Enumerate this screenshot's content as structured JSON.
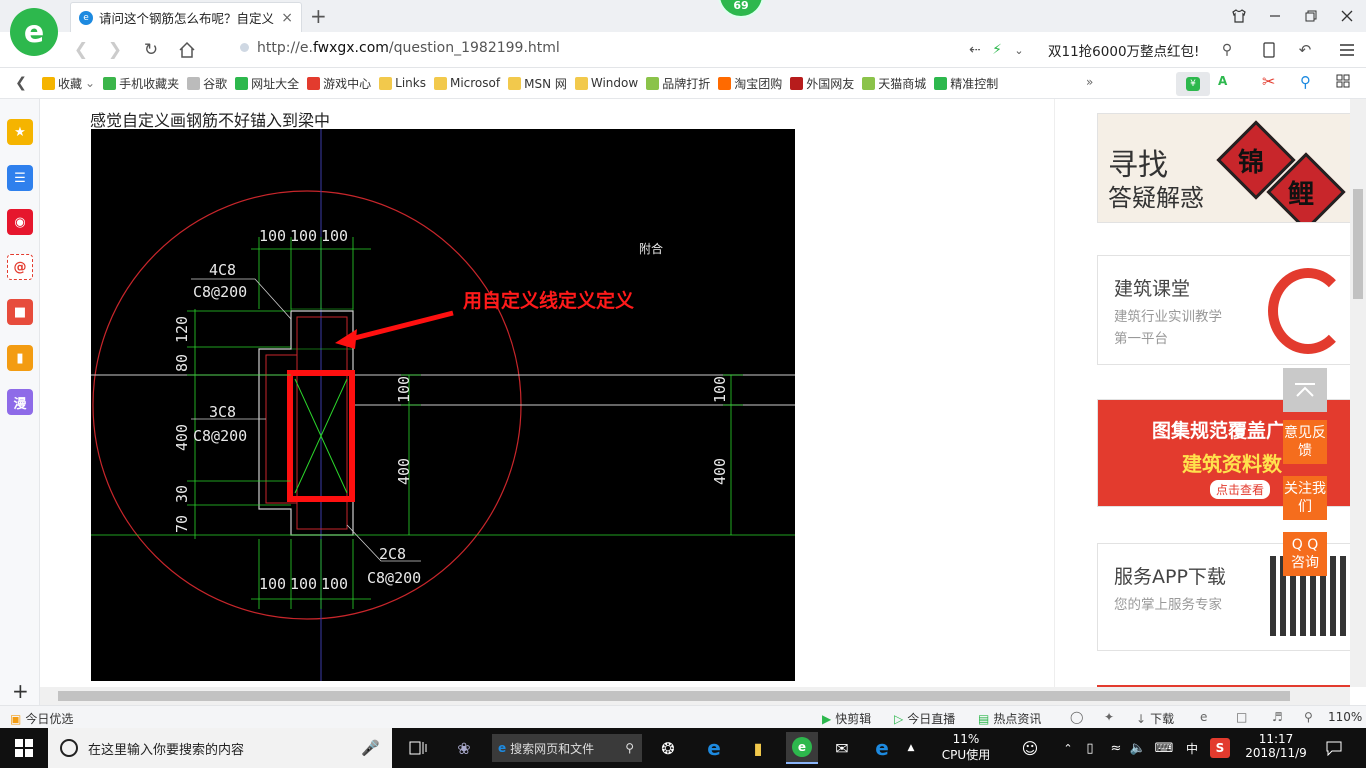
{
  "browser": {
    "tab_title": "请问这个钢筋怎么布呢？自定义画",
    "tab_close": "×",
    "new_tab": "+",
    "badge_count": "69",
    "url_prefix": "http://e.",
    "url_domain": "fwxgx.com",
    "url_path": "/question_1982199.html",
    "promo_text": "双11抢6000万整点红包!"
  },
  "bookmarks": [
    {
      "label": "收藏",
      "icon": "star-icon",
      "color": "#f5b400"
    },
    {
      "label": "手机收藏夹",
      "icon": "phone-icon",
      "color": "#3bb54a"
    },
    {
      "label": "谷歌",
      "icon": "page-icon",
      "color": "#bbbbbb"
    },
    {
      "label": "网址大全",
      "icon": "globe-icon",
      "color": "#2db84d"
    },
    {
      "label": "游戏中心",
      "icon": "game-icon",
      "color": "#e33b2e"
    },
    {
      "label": "Links",
      "icon": "folder-icon",
      "color": "#f2c94c"
    },
    {
      "label": "Microsof",
      "icon": "folder-icon",
      "color": "#f2c94c"
    },
    {
      "label": "MSN 网",
      "icon": "folder-icon",
      "color": "#f2c94c"
    },
    {
      "label": "Window",
      "icon": "folder-icon",
      "color": "#f2c94c"
    },
    {
      "label": "品牌打折",
      "icon": "leaf-icon",
      "color": "#8bc34a"
    },
    {
      "label": "淘宝团购",
      "icon": "taobao-icon",
      "color": "#ff6a00"
    },
    {
      "label": "外国网友",
      "icon": "foreign-icon",
      "color": "#b71c1c"
    },
    {
      "label": "天猫商城",
      "icon": "tmall-icon",
      "color": "#8bc34a"
    },
    {
      "label": "精准控制",
      "icon": "wechat-icon",
      "color": "#2db84d"
    }
  ],
  "content": {
    "question_text": "感觉自定义画钢筋不好锚入到梁中",
    "cad": {
      "annotation": "用自定义线定义定义",
      "dim_top": [
        "100",
        "100",
        "100"
      ],
      "dim_bottom": [
        "100",
        "100",
        "100"
      ],
      "label_4c8": "4C8",
      "label_c8_top": "C8@200",
      "label_3c8": "3C8",
      "label_c8_mid": "C8@200",
      "label_2c8": "2C8",
      "label_c8_bot": "C8@200",
      "dim_left": [
        "120",
        "80",
        "400",
        "30",
        "70"
      ],
      "dim_right_1": [
        "100",
        "400"
      ],
      "dim_right_2": [
        "100",
        "400"
      ],
      "corner_text": "附合"
    }
  },
  "sidebar_ads": {
    "ad1_line1": "寻找",
    "ad1_line2": "答疑解惑",
    "ad1_badge1": "锦",
    "ad1_badge2": "鲤",
    "ad2_title": "建筑课堂",
    "ad2_sub": "建筑行业实训教学第一平台",
    "ad3_line1": "图集规范覆盖广",
    "ad3_line2": "建筑资料数",
    "ad3_btn": "点击查看",
    "ad4_title": "服务APP下载",
    "ad4_sub": "您的掌上服务专家"
  },
  "float_buttons": [
    "意见反馈",
    "关注我们",
    "Q Q 咨询"
  ],
  "statusbar": {
    "left": "今日优选",
    "items": [
      "快剪辑",
      "今日直播",
      "热点资讯",
      "下载"
    ],
    "zoom": "110%"
  },
  "taskbar": {
    "search_placeholder": "在这里输入你要搜索的内容",
    "web_search": "搜索网页和文件",
    "cpu_percent": "11%",
    "cpu_label": "CPU使用",
    "ime": "中",
    "time": "11:17",
    "date": "2018/11/9"
  }
}
